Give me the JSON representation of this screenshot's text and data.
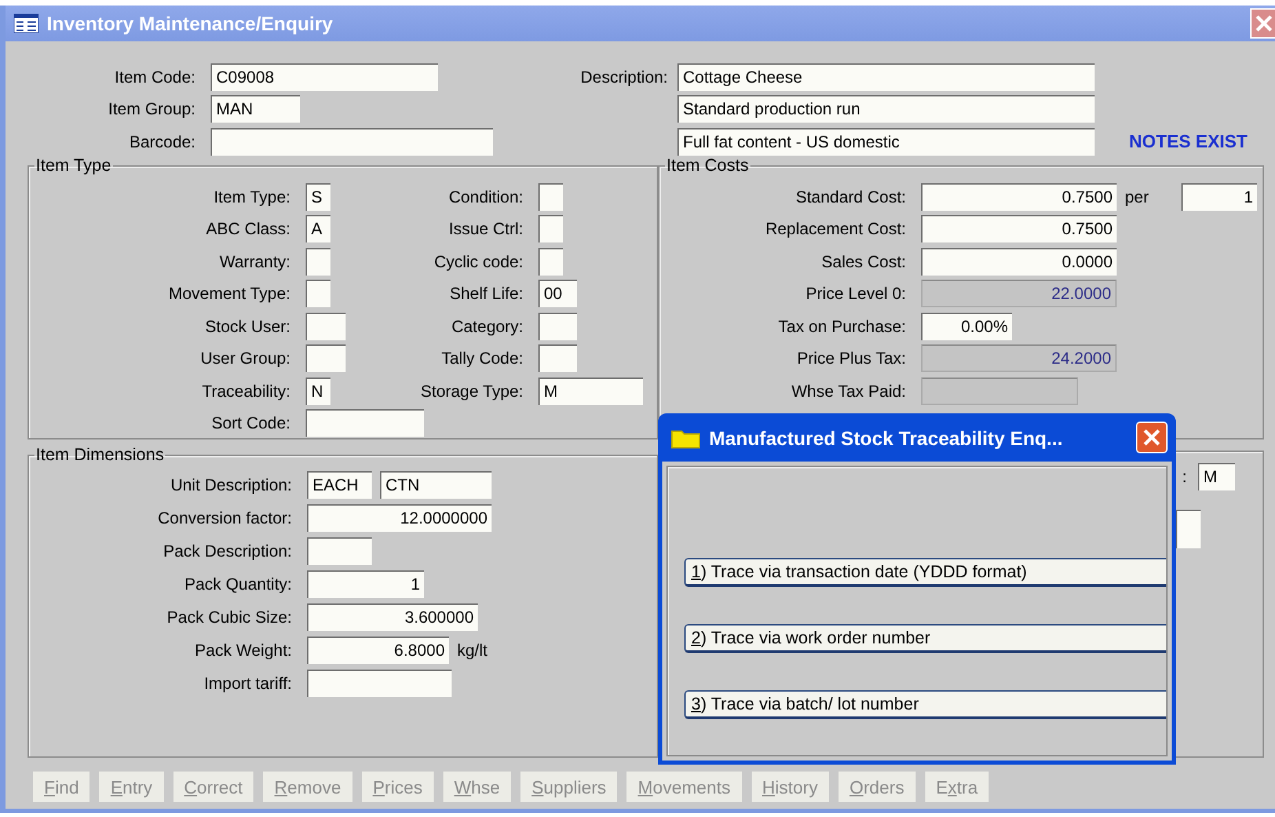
{
  "window": {
    "title": "Inventory Maintenance/Enquiry"
  },
  "header": {
    "fields": [
      {
        "label": "Item Code:",
        "value": "C09008"
      },
      {
        "label": "Item Group:",
        "value": "MAN"
      },
      {
        "label": "Barcode:"
      }
    ],
    "description": {
      "label": "Description:",
      "lines": [
        "Cottage Cheese",
        "Standard production run",
        "Full fat content - US domestic"
      ]
    },
    "notes_flag": "NOTES EXIST"
  },
  "item_type": {
    "title": "Item Type",
    "left": [
      {
        "label": "Item Type:",
        "value": "S"
      },
      {
        "label": "ABC Class:",
        "value": "A"
      },
      {
        "label": "Warranty:"
      },
      {
        "label": "Movement Type:"
      },
      {
        "label": "Stock User:"
      },
      {
        "label": "User Group:"
      },
      {
        "label": "Traceability:",
        "value": "N"
      },
      {
        "label": "Sort Code:"
      }
    ],
    "right": [
      {
        "label": "Condition:"
      },
      {
        "label": "Issue Ctrl:"
      },
      {
        "label": "Cyclic code:"
      },
      {
        "label": "Shelf Life:",
        "value": "00"
      },
      {
        "label": "Category:"
      },
      {
        "label": "Tally Code:"
      },
      {
        "label": "Storage Type:",
        "value": "M"
      }
    ]
  },
  "item_costs": {
    "title": "Item Costs",
    "rows": [
      {
        "label": "Standard Cost:",
        "value": "0.7500",
        "readonly": false,
        "per_label": "per",
        "per_value": "1"
      },
      {
        "label": "Replacement Cost:",
        "value": "0.7500",
        "readonly": false
      },
      {
        "label": "Sales Cost:",
        "value": "0.0000",
        "readonly": false
      },
      {
        "label": "Price Level 0:",
        "value": "22.0000",
        "readonly": true
      },
      {
        "label": "Tax on Purchase:",
        "value": "0.00%",
        "readonly": false
      },
      {
        "label": "Price Plus Tax:",
        "value": "24.2000",
        "readonly": true
      },
      {
        "label": "Whse Tax Paid:",
        "readonly": true
      }
    ]
  },
  "lower_right_group": {
    "rows": [
      {
        "label": ":",
        "value": "M"
      },
      {}
    ]
  },
  "item_dimensions": {
    "title": "Item Dimensions",
    "rows": [
      {
        "label": "Unit Description:",
        "fields": [
          {
            "value": "EACH",
            "kind": "text"
          },
          {
            "value": "CTN",
            "kind": "text"
          }
        ]
      },
      {
        "label": "Conversion factor:",
        "fields": [
          {
            "value": "12.0000000",
            "kind": "number"
          }
        ]
      },
      {
        "label": "Pack Description:",
        "fields": [
          {
            "kind": "text"
          }
        ]
      },
      {
        "label": "Pack Quantity:",
        "fields": [
          {
            "value": "1",
            "kind": "number"
          }
        ]
      },
      {
        "label": "Pack Cubic Size:",
        "fields": [
          {
            "value": "3.600000",
            "kind": "number"
          }
        ]
      },
      {
        "label": "Pack Weight:",
        "fields": [
          {
            "value": "6.8000",
            "kind": "number"
          }
        ],
        "unit": "kg/lt"
      },
      {
        "label": "Import tariff:",
        "fields": [
          {
            "kind": "text"
          }
        ]
      }
    ]
  },
  "toolbar": [
    {
      "key": "F",
      "post": "ind",
      "disabled": true
    },
    {
      "key": "E",
      "post": "ntry",
      "disabled": true
    },
    {
      "key": "C",
      "post": "orrect",
      "disabled": true
    },
    {
      "key": "R",
      "post": "emove",
      "disabled": true
    },
    {
      "key": "P",
      "post": "rices",
      "disabled": true
    },
    {
      "key": "W",
      "post": "hse",
      "disabled": true
    },
    {
      "key": "S",
      "post": "uppliers",
      "disabled": true
    },
    {
      "key": "M",
      "post": "ovements",
      "disabled": true
    },
    {
      "key": "H",
      "post": "istory",
      "disabled": true
    },
    {
      "key": "O",
      "post": "rders",
      "disabled": true
    },
    {
      "pre": "E",
      "key": "x",
      "post": "tra",
      "disabled": true
    }
  ],
  "dialog": {
    "title": "Manufactured Stock Traceability Enq...",
    "options": [
      {
        "key": "1",
        "post": ") Trace via transaction date (YDDD format)"
      },
      {
        "key": "2",
        "post": ") Trace via work order number"
      },
      {
        "key": "3",
        "post": ") Trace via batch/ lot number"
      }
    ]
  }
}
